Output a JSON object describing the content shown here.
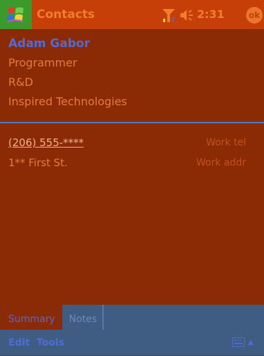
{
  "titlebar": {
    "app_title": "Contacts",
    "clock": "2:31",
    "ok_label": "ok",
    "icons": {
      "start": "windows-flag-icon",
      "signal": "signal-strength-icon",
      "volume": "speaker-icon"
    }
  },
  "contact": {
    "name": "Adam Gabor",
    "job_title": "Programmer",
    "department": "R&D",
    "company": "Inspired Technologies"
  },
  "details": [
    {
      "value": "(206) 555-****",
      "label": "Work tel"
    },
    {
      "value": "1** First St.",
      "label": "Work addr"
    }
  ],
  "tabs": [
    {
      "label": "Summary",
      "selected": true
    },
    {
      "label": "Notes",
      "selected": false
    }
  ],
  "menu": {
    "edit_label": "Edit",
    "tools_label": "Tools",
    "keyboard_icon": "keyboard-icon",
    "arrow": "▲"
  },
  "colors": {
    "background": "#8a2b06",
    "titlebar": "#c63e08",
    "accent_blue": "#4f6bd6",
    "text_orange": "#e67b34",
    "bar_blue": "#3f5d82"
  }
}
